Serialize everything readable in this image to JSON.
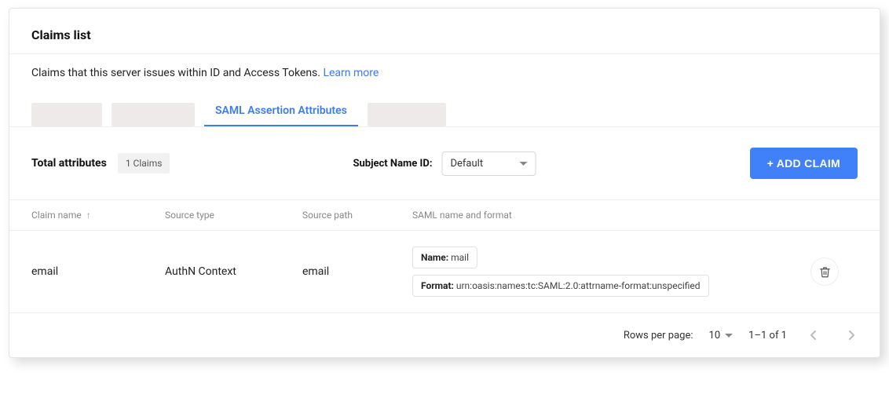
{
  "header": {
    "title": "Claims list"
  },
  "description": {
    "text": "Claims that this server issues within ID and Access Tokens. ",
    "link_label": "Learn more"
  },
  "tabs": {
    "active_label": "SAML Assertion Attributes"
  },
  "summary": {
    "label": "Total attributes",
    "badge": "1 Claims",
    "subject_label": "Subject Name ID:",
    "subject_value": "Default"
  },
  "add_button": "+ ADD CLAIM",
  "columns": {
    "claim": "Claim name",
    "source_type": "Source type",
    "source_path": "Source path",
    "saml": "SAML name and format"
  },
  "row": {
    "claim": "email",
    "source_type": "AuthN Context",
    "source_path": "email",
    "saml_name_key": "Name:",
    "saml_name_val": " mail",
    "saml_format_key": "Format:",
    "saml_format_val": " urn:oasis:names:tc:SAML:2.0:attrname-format:unspecified"
  },
  "pager": {
    "rows_label": "Rows per page:",
    "rows_value": "10",
    "range": "1–1 of 1"
  }
}
